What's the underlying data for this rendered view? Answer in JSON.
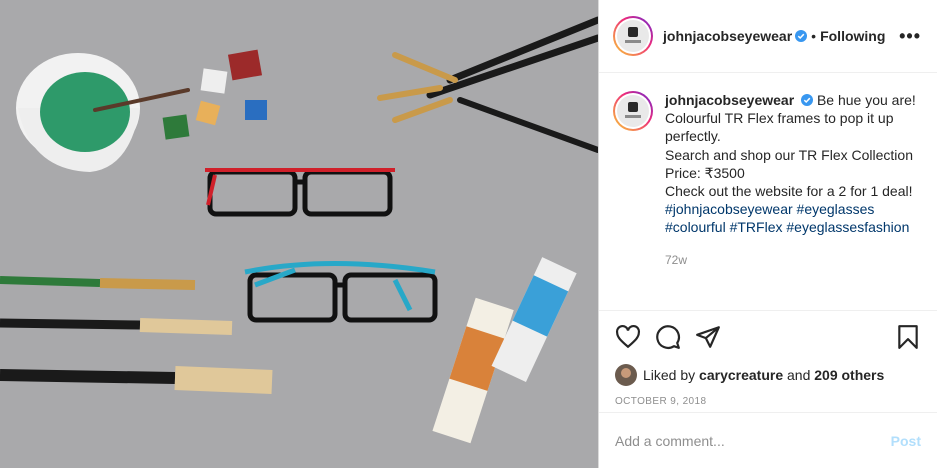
{
  "header": {
    "username": "johnjacobseyewear",
    "separator": "•",
    "follow_state": "Following",
    "more_icon": "more-horizontal-icon",
    "more_label": "•••"
  },
  "caption": {
    "username": "johnjacobseyewear",
    "lines": [
      "Be hue you are!",
      "Colourful TR Flex frames to pop it up perfectly.",
      "Search and shop our TR Flex Collection",
      "Price: ₹3500",
      "Check out the website for a 2 for 1 deal!"
    ],
    "hashtags": [
      "#johnjacobseyewear",
      "#eyeglasses",
      "#colourful",
      "#TRFlex",
      "#eyeglassesfashion"
    ],
    "age": "72w"
  },
  "actions": {
    "like_icon": "heart-icon",
    "comment_icon": "comment-icon",
    "share_icon": "share-icon",
    "save_icon": "bookmark-icon"
  },
  "likes": {
    "prefix": "Liked by",
    "user": "carycreature",
    "and": "and",
    "others": "209 others"
  },
  "date": "OCTOBER 9, 2018",
  "comment": {
    "placeholder": "Add a comment...",
    "post_label": "Post"
  },
  "colors": {
    "verified": "#3897f0",
    "hashtag": "#00376b",
    "post_disabled": "#b2dffc"
  }
}
